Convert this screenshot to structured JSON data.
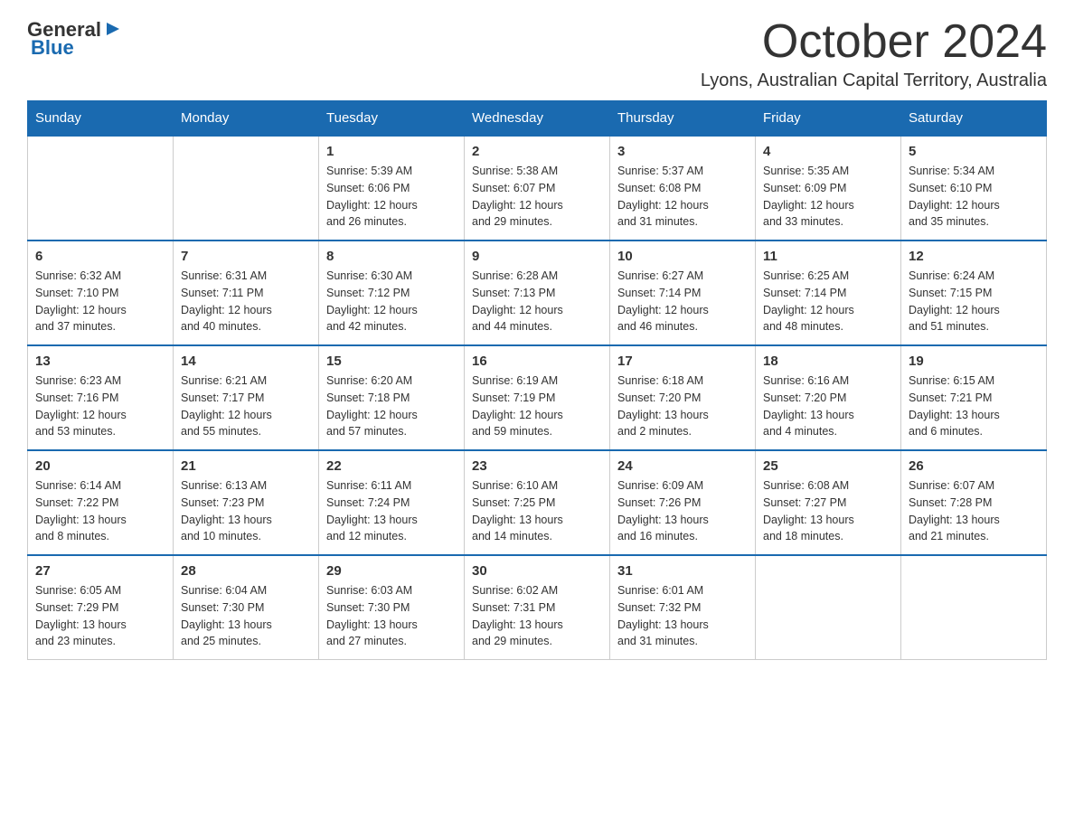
{
  "logo": {
    "general": "General",
    "blue": "Blue"
  },
  "title": "October 2024",
  "subtitle": "Lyons, Australian Capital Territory, Australia",
  "days_of_week": [
    "Sunday",
    "Monday",
    "Tuesday",
    "Wednesday",
    "Thursday",
    "Friday",
    "Saturday"
  ],
  "weeks": [
    [
      {
        "day": "",
        "info": ""
      },
      {
        "day": "",
        "info": ""
      },
      {
        "day": "1",
        "info": "Sunrise: 5:39 AM\nSunset: 6:06 PM\nDaylight: 12 hours\nand 26 minutes."
      },
      {
        "day": "2",
        "info": "Sunrise: 5:38 AM\nSunset: 6:07 PM\nDaylight: 12 hours\nand 29 minutes."
      },
      {
        "day": "3",
        "info": "Sunrise: 5:37 AM\nSunset: 6:08 PM\nDaylight: 12 hours\nand 31 minutes."
      },
      {
        "day": "4",
        "info": "Sunrise: 5:35 AM\nSunset: 6:09 PM\nDaylight: 12 hours\nand 33 minutes."
      },
      {
        "day": "5",
        "info": "Sunrise: 5:34 AM\nSunset: 6:10 PM\nDaylight: 12 hours\nand 35 minutes."
      }
    ],
    [
      {
        "day": "6",
        "info": "Sunrise: 6:32 AM\nSunset: 7:10 PM\nDaylight: 12 hours\nand 37 minutes."
      },
      {
        "day": "7",
        "info": "Sunrise: 6:31 AM\nSunset: 7:11 PM\nDaylight: 12 hours\nand 40 minutes."
      },
      {
        "day": "8",
        "info": "Sunrise: 6:30 AM\nSunset: 7:12 PM\nDaylight: 12 hours\nand 42 minutes."
      },
      {
        "day": "9",
        "info": "Sunrise: 6:28 AM\nSunset: 7:13 PM\nDaylight: 12 hours\nand 44 minutes."
      },
      {
        "day": "10",
        "info": "Sunrise: 6:27 AM\nSunset: 7:14 PM\nDaylight: 12 hours\nand 46 minutes."
      },
      {
        "day": "11",
        "info": "Sunrise: 6:25 AM\nSunset: 7:14 PM\nDaylight: 12 hours\nand 48 minutes."
      },
      {
        "day": "12",
        "info": "Sunrise: 6:24 AM\nSunset: 7:15 PM\nDaylight: 12 hours\nand 51 minutes."
      }
    ],
    [
      {
        "day": "13",
        "info": "Sunrise: 6:23 AM\nSunset: 7:16 PM\nDaylight: 12 hours\nand 53 minutes."
      },
      {
        "day": "14",
        "info": "Sunrise: 6:21 AM\nSunset: 7:17 PM\nDaylight: 12 hours\nand 55 minutes."
      },
      {
        "day": "15",
        "info": "Sunrise: 6:20 AM\nSunset: 7:18 PM\nDaylight: 12 hours\nand 57 minutes."
      },
      {
        "day": "16",
        "info": "Sunrise: 6:19 AM\nSunset: 7:19 PM\nDaylight: 12 hours\nand 59 minutes."
      },
      {
        "day": "17",
        "info": "Sunrise: 6:18 AM\nSunset: 7:20 PM\nDaylight: 13 hours\nand 2 minutes."
      },
      {
        "day": "18",
        "info": "Sunrise: 6:16 AM\nSunset: 7:20 PM\nDaylight: 13 hours\nand 4 minutes."
      },
      {
        "day": "19",
        "info": "Sunrise: 6:15 AM\nSunset: 7:21 PM\nDaylight: 13 hours\nand 6 minutes."
      }
    ],
    [
      {
        "day": "20",
        "info": "Sunrise: 6:14 AM\nSunset: 7:22 PM\nDaylight: 13 hours\nand 8 minutes."
      },
      {
        "day": "21",
        "info": "Sunrise: 6:13 AM\nSunset: 7:23 PM\nDaylight: 13 hours\nand 10 minutes."
      },
      {
        "day": "22",
        "info": "Sunrise: 6:11 AM\nSunset: 7:24 PM\nDaylight: 13 hours\nand 12 minutes."
      },
      {
        "day": "23",
        "info": "Sunrise: 6:10 AM\nSunset: 7:25 PM\nDaylight: 13 hours\nand 14 minutes."
      },
      {
        "day": "24",
        "info": "Sunrise: 6:09 AM\nSunset: 7:26 PM\nDaylight: 13 hours\nand 16 minutes."
      },
      {
        "day": "25",
        "info": "Sunrise: 6:08 AM\nSunset: 7:27 PM\nDaylight: 13 hours\nand 18 minutes."
      },
      {
        "day": "26",
        "info": "Sunrise: 6:07 AM\nSunset: 7:28 PM\nDaylight: 13 hours\nand 21 minutes."
      }
    ],
    [
      {
        "day": "27",
        "info": "Sunrise: 6:05 AM\nSunset: 7:29 PM\nDaylight: 13 hours\nand 23 minutes."
      },
      {
        "day": "28",
        "info": "Sunrise: 6:04 AM\nSunset: 7:30 PM\nDaylight: 13 hours\nand 25 minutes."
      },
      {
        "day": "29",
        "info": "Sunrise: 6:03 AM\nSunset: 7:30 PM\nDaylight: 13 hours\nand 27 minutes."
      },
      {
        "day": "30",
        "info": "Sunrise: 6:02 AM\nSunset: 7:31 PM\nDaylight: 13 hours\nand 29 minutes."
      },
      {
        "day": "31",
        "info": "Sunrise: 6:01 AM\nSunset: 7:32 PM\nDaylight: 13 hours\nand 31 minutes."
      },
      {
        "day": "",
        "info": ""
      },
      {
        "day": "",
        "info": ""
      }
    ]
  ]
}
